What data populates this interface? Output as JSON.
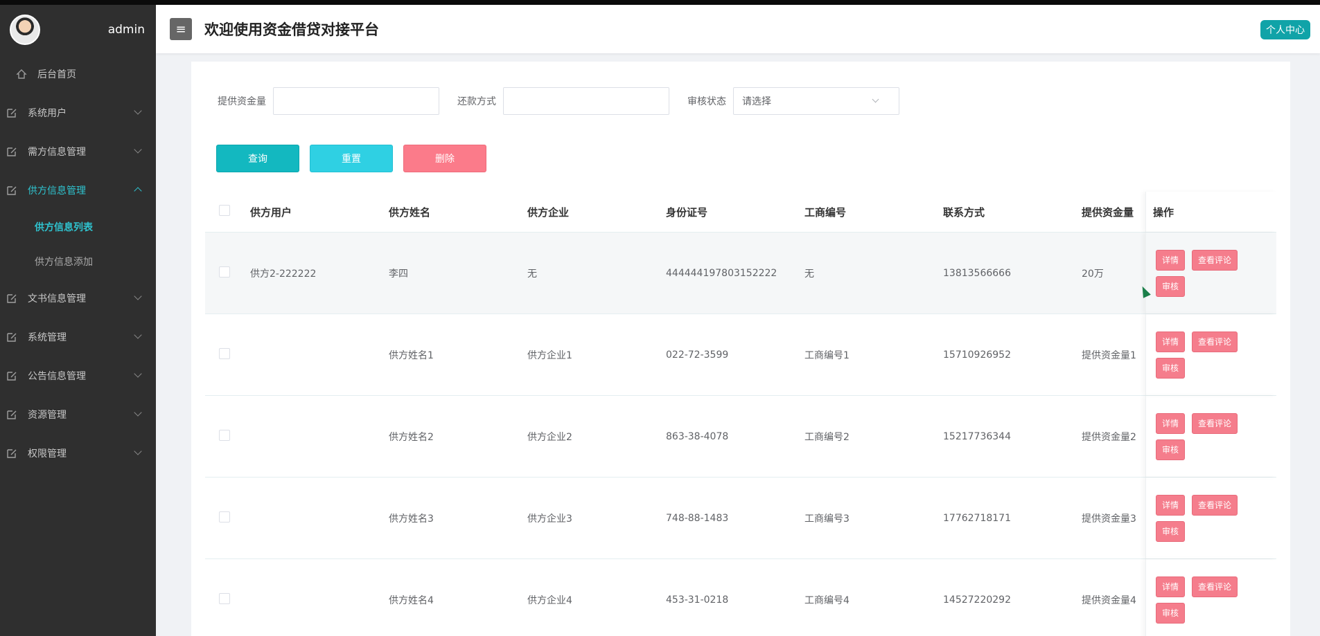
{
  "sidebar": {
    "username": "admin",
    "home": "后台首页",
    "menu": [
      {
        "label": "系统用户"
      },
      {
        "label": "需方信息管理"
      },
      {
        "label": "供方信息管理"
      },
      {
        "label": "文书信息管理"
      },
      {
        "label": "系统管理"
      },
      {
        "label": "公告信息管理"
      },
      {
        "label": "资源管理"
      },
      {
        "label": "权限管理"
      }
    ],
    "submenu": [
      {
        "label": "供方信息列表"
      },
      {
        "label": "供方信息添加"
      }
    ]
  },
  "header": {
    "menu_icon": "≡",
    "title": "欢迎使用资金借贷对接平台",
    "profile_label": "个人中心"
  },
  "filters": {
    "amount_label": "提供资金量",
    "amount_value": "",
    "repay_label": "还款方式",
    "repay_value": "",
    "status_label": "审核状态",
    "status_placeholder": "请选择"
  },
  "actions": {
    "query": "查询",
    "reset": "重置",
    "delete": "删除"
  },
  "table": {
    "headers": [
      "供方用户",
      "供方姓名",
      "供方企业",
      "身份证号",
      "工商编号",
      "联系方式",
      "提供资金量",
      "操作"
    ],
    "op_labels": {
      "detail": "详情",
      "comments": "查看评论",
      "audit": "审核"
    },
    "rows": [
      [
        "供方2-222222",
        "李四",
        "无",
        "444444197803152222",
        "无",
        "13813566666",
        "20万"
      ],
      [
        "",
        "供方姓名1",
        "供方企业1",
        "022-72-3599",
        "工商编号1",
        "15710926952",
        "提供资金量1"
      ],
      [
        "",
        "供方姓名2",
        "供方企业2",
        "863-38-4078",
        "工商编号2",
        "15217736344",
        "提供资金量2"
      ],
      [
        "",
        "供方姓名3",
        "供方企业3",
        "748-88-1483",
        "工商编号3",
        "17762718171",
        "提供资金量3"
      ],
      [
        "",
        "供方姓名4",
        "供方企业4",
        "453-31-0218",
        "工商编号4",
        "14527220292",
        "提供资金量4"
      ]
    ]
  },
  "colors": {
    "accent": "#2fc3cf",
    "query_btn": "#13b8c0",
    "reset_btn": "#2fd0e3",
    "delete_btn": "#fb7b8a",
    "sidebar_bg": "#2f2f2f"
  }
}
